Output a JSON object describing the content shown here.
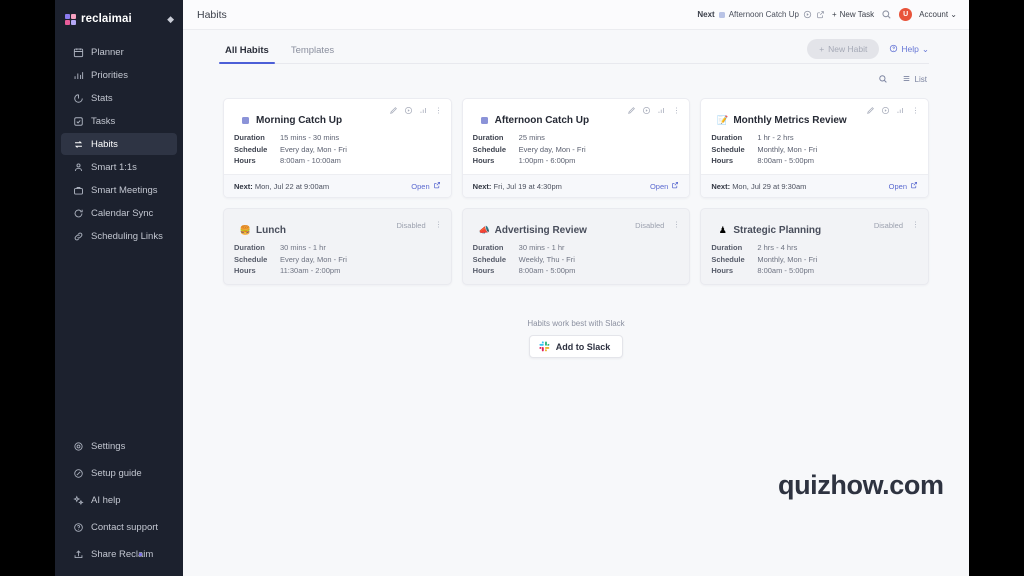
{
  "sidebar": {
    "brand": "reclaimai",
    "pin_icon": "pin-icon",
    "items": [
      {
        "label": "Planner",
        "icon": "calendar-icon"
      },
      {
        "label": "Priorities",
        "icon": "bar-chart-icon"
      },
      {
        "label": "Stats",
        "icon": "activity-icon"
      },
      {
        "label": "Tasks",
        "icon": "check-square-icon"
      },
      {
        "label": "Habits",
        "icon": "repeat-icon",
        "active": true
      },
      {
        "label": "Smart 1:1s",
        "icon": "users-icon"
      },
      {
        "label": "Smart Meetings",
        "icon": "briefcase-icon"
      },
      {
        "label": "Calendar Sync",
        "icon": "refresh-icon"
      },
      {
        "label": "Scheduling Links",
        "icon": "link-icon"
      }
    ],
    "bottom_items": [
      {
        "label": "Settings",
        "icon": "gear-icon"
      },
      {
        "label": "Setup guide",
        "icon": "compass-icon"
      },
      {
        "label": "AI help",
        "icon": "sparkle-icon"
      },
      {
        "label": "Contact support",
        "icon": "help-circle-icon"
      },
      {
        "label": "Share Reclaim",
        "icon": "share-icon"
      }
    ]
  },
  "topbar": {
    "page_title": "Habits",
    "next_label": "Next",
    "next_task": "Afternoon Catch Up",
    "play_icon": "play-circle-icon",
    "external_icon": "external-link-icon",
    "new_task_label": "New Task",
    "search_icon": "search-icon",
    "avatar_initial": "U",
    "account_label": "Account"
  },
  "tabs": [
    {
      "label": "All Habits",
      "active": true
    },
    {
      "label": "Templates",
      "active": false
    }
  ],
  "actions": {
    "new_habit_label": "New Habit",
    "new_habit_disabled": true,
    "help_label": "Help",
    "search_icon": "search-icon",
    "list_label": "List",
    "list_icon": "list-icon"
  },
  "habits": [
    {
      "title": "Morning Catch Up",
      "emoji": "square",
      "disabled": false,
      "duration_label": "Duration",
      "duration": "15 mins - 30 mins",
      "schedule_label": "Schedule",
      "schedule": "Every day, Mon - Fri",
      "hours_label": "Hours",
      "hours": "8:00am - 10:00am",
      "next_label": "Next:",
      "next_value": "Mon, Jul 22 at 9:00am",
      "open_label": "Open"
    },
    {
      "title": "Afternoon Catch Up",
      "emoji": "square",
      "disabled": false,
      "duration_label": "Duration",
      "duration": "25 mins",
      "schedule_label": "Schedule",
      "schedule": "Every day, Mon - Fri",
      "hours_label": "Hours",
      "hours": "1:00pm - 6:00pm",
      "next_label": "Next:",
      "next_value": "Fri, Jul 19 at 4:30pm",
      "open_label": "Open"
    },
    {
      "title": "Monthly Metrics Review",
      "emoji": "📝",
      "disabled": false,
      "duration_label": "Duration",
      "duration": "1 hr - 2 hrs",
      "schedule_label": "Schedule",
      "schedule": "Monthly, Mon - Fri",
      "hours_label": "Hours",
      "hours": "8:00am - 5:00pm",
      "next_label": "Next:",
      "next_value": "Mon, Jul 29 at 9:30am",
      "open_label": "Open"
    },
    {
      "title": "Lunch",
      "emoji": "🍔",
      "disabled": true,
      "disabled_label": "Disabled",
      "duration_label": "Duration",
      "duration": "30 mins - 1 hr",
      "schedule_label": "Schedule",
      "schedule": "Every day, Mon - Fri",
      "hours_label": "Hours",
      "hours": "11:30am - 2:00pm"
    },
    {
      "title": "Advertising Review",
      "emoji": "📣",
      "disabled": true,
      "disabled_label": "Disabled",
      "duration_label": "Duration",
      "duration": "30 mins - 1 hr",
      "schedule_label": "Schedule",
      "schedule": "Weekly, Thu - Fri",
      "hours_label": "Hours",
      "hours": "8:00am - 5:00pm"
    },
    {
      "title": "Strategic Planning",
      "emoji": "♟",
      "disabled": true,
      "disabled_label": "Disabled",
      "duration_label": "Duration",
      "duration": "2 hrs - 4 hrs",
      "schedule_label": "Schedule",
      "schedule": "Monthly, Mon - Fri",
      "hours_label": "Hours",
      "hours": "8:00am - 5:00pm"
    }
  ],
  "card_action_icons": {
    "edit": "pencil-icon",
    "play": "play-circle-icon",
    "stats": "bar-chart-icon",
    "more": "more-vertical-icon"
  },
  "slack": {
    "caption": "Habits work best with Slack",
    "button_label": "Add to Slack"
  },
  "watermark": "quizhow.com",
  "colors": {
    "accent": "#4c5fd7",
    "sidebar_bg": "#1c212e",
    "canvas_bg": "#f7f8fa",
    "link": "#5b6ad0",
    "avatar": "#e8533a"
  }
}
